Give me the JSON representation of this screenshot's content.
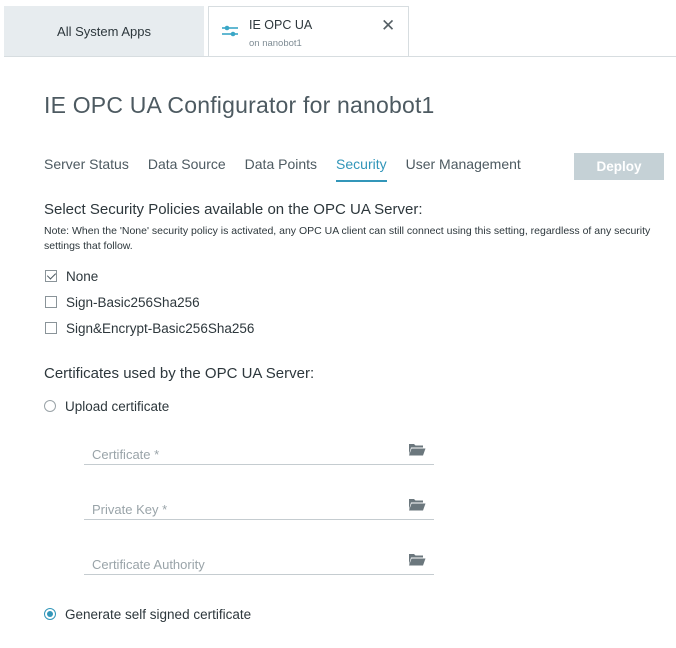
{
  "tabs": {
    "all_apps": "All System Apps",
    "active_title": "IE OPC UA",
    "active_subtitle": "on nanobot1",
    "close_glyph": "✕"
  },
  "page": {
    "title": "IE OPC UA Configurator for nanobot1"
  },
  "nav": {
    "items": [
      "Server Status",
      "Data Source",
      "Data Points",
      "Security",
      "User Management"
    ],
    "active": "Security",
    "deploy_label": "Deploy"
  },
  "security": {
    "policies_title": "Select Security Policies available on the OPC UA Server:",
    "note": "Note: When the 'None' security policy is activated, any OPC UA client can still connect using this setting, regardless of any security settings that follow.",
    "policies": [
      {
        "label": "None",
        "checked": true
      },
      {
        "label": "Sign-Basic256Sha256",
        "checked": false
      },
      {
        "label": "Sign&Encrypt-Basic256Sha256",
        "checked": false
      }
    ]
  },
  "certificates": {
    "title": "Certificates used by the OPC UA Server:",
    "upload_label": "Upload certificate",
    "certificate_placeholder": "Certificate *",
    "private_key_placeholder": "Private Key *",
    "authority_placeholder": "Certificate Authority",
    "generate_label": "Generate self signed certificate",
    "selected": "generate"
  },
  "colors": {
    "accent": "#3296b9",
    "deploy_disabled": "#c5d1d6",
    "tab_inactive": "#e7ecef"
  }
}
